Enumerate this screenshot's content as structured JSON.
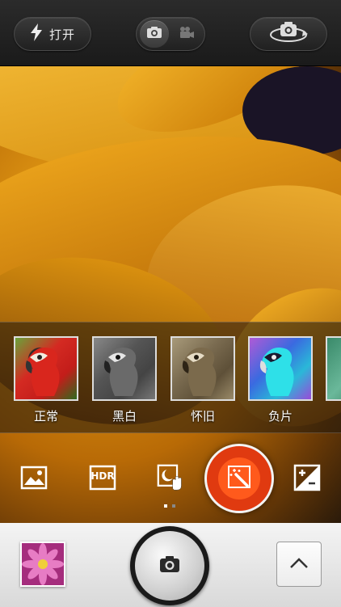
{
  "topbar": {
    "flash_label": "打开"
  },
  "filters": [
    {
      "label": "正常",
      "style": "normal"
    },
    {
      "label": "黑白",
      "style": "mono"
    },
    {
      "label": "怀旧",
      "style": "sepia"
    },
    {
      "label": "负片",
      "style": "negative"
    },
    {
      "label": "",
      "style": "partial"
    }
  ],
  "mode_row": {
    "page_dots": 2,
    "active_page": 1,
    "icons": [
      "landscape-icon",
      "hdr-icon",
      "night-hand-icon",
      "magic-wand-icon",
      "exposure-icon"
    ],
    "hdr_text": "HDR"
  },
  "colors": {
    "accent": "#e03a10",
    "petal": "#e8a11a"
  }
}
